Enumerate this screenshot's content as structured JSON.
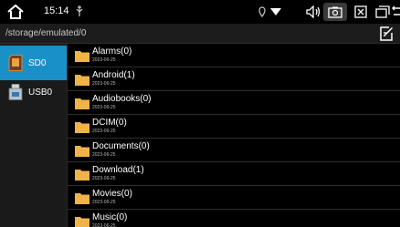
{
  "status_bar": {
    "time": "15:14",
    "icons": [
      "home-icon",
      "usb-icon",
      "location-icon",
      "wifi-icon",
      "volume-icon",
      "screenshot-icon",
      "close-box-icon",
      "recent-apps-icon",
      "back-icon"
    ]
  },
  "path_bar": {
    "path": "/storage/emulated/0",
    "edit_icon": "edit-icon"
  },
  "sidebar": {
    "items": [
      {
        "label": "SD0",
        "icon": "sd-card-icon",
        "selected": true
      },
      {
        "label": "USB0",
        "icon": "usb-drive-icon",
        "selected": false
      }
    ]
  },
  "files": [
    {
      "name": "Alarms(0)",
      "date": "2023-06-25"
    },
    {
      "name": "Android(1)",
      "date": "2023-06-25"
    },
    {
      "name": "Audiobooks(0)",
      "date": "2023-06-25"
    },
    {
      "name": "DCIM(0)",
      "date": "2023-06-25"
    },
    {
      "name": "Documents(0)",
      "date": "2023-06-25"
    },
    {
      "name": "Download(1)",
      "date": "2023-06-25"
    },
    {
      "name": "Movies(0)",
      "date": "2023-06-25"
    },
    {
      "name": "Music(0)",
      "date": "2023-06-25"
    }
  ],
  "colors": {
    "accent": "#1a90c8",
    "folder": "#f0b34a",
    "background": "#000000"
  }
}
